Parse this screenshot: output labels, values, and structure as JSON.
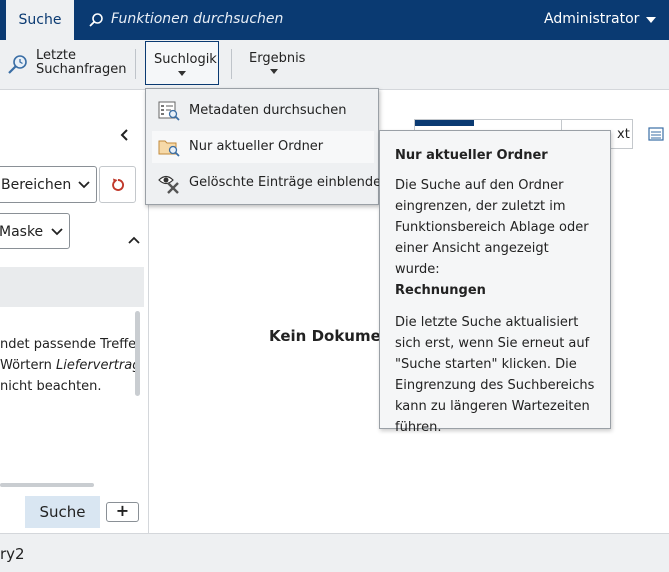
{
  "topbar": {
    "active_tab": "Suche",
    "search_placeholder": "Funktionen durchsuchen",
    "user": "Administrator"
  },
  "ribbon": {
    "recent_line1": "Letzte",
    "recent_line2": "Suchanfragen",
    "suchlogik": "Suchlogik",
    "ergebnis": "Ergebnis"
  },
  "dropdown": {
    "items": [
      {
        "label": "Metadaten durchsuchen",
        "icon": "metadata-search-icon"
      },
      {
        "label": "Nur aktueller Ordner",
        "icon": "folder-search-icon"
      },
      {
        "label": "Gelöschte Einträge einblenden",
        "icon": "show-deleted-icon"
      }
    ]
  },
  "tooltip": {
    "title": "Nur aktueller Ordner",
    "p1": "Die Suche auf den Ordner eingrenzen, der zuletzt im Funktionsbereich Ablage oder einer Ansicht angezeigt wurde:",
    "p1_bold": "Rechnungen",
    "p2": "Die letzte Suche aktualisiert sich erst, wenn Sie erneut auf \"Suche starten\" klicken. Die Eingrenzung des Suchbereichs kann zu längeren Wartezeiten führen."
  },
  "left": {
    "select1": "Bereichen",
    "select2": "Maske",
    "hint_line1": "ndet passende Treffer.",
    "hint_line2_pre": "Wörtern ",
    "hint_line2_em": "Liefervertrag",
    "hint_line3": "nicht beachten.",
    "search_button": "Suche",
    "plus_button": "+"
  },
  "main": {
    "seg_text": "xt",
    "empty_text": "Kein Dokume"
  },
  "status": {
    "text": "ry2"
  },
  "colors": {
    "brand": "#0a3a72",
    "reset_icon": "#c0392b"
  }
}
